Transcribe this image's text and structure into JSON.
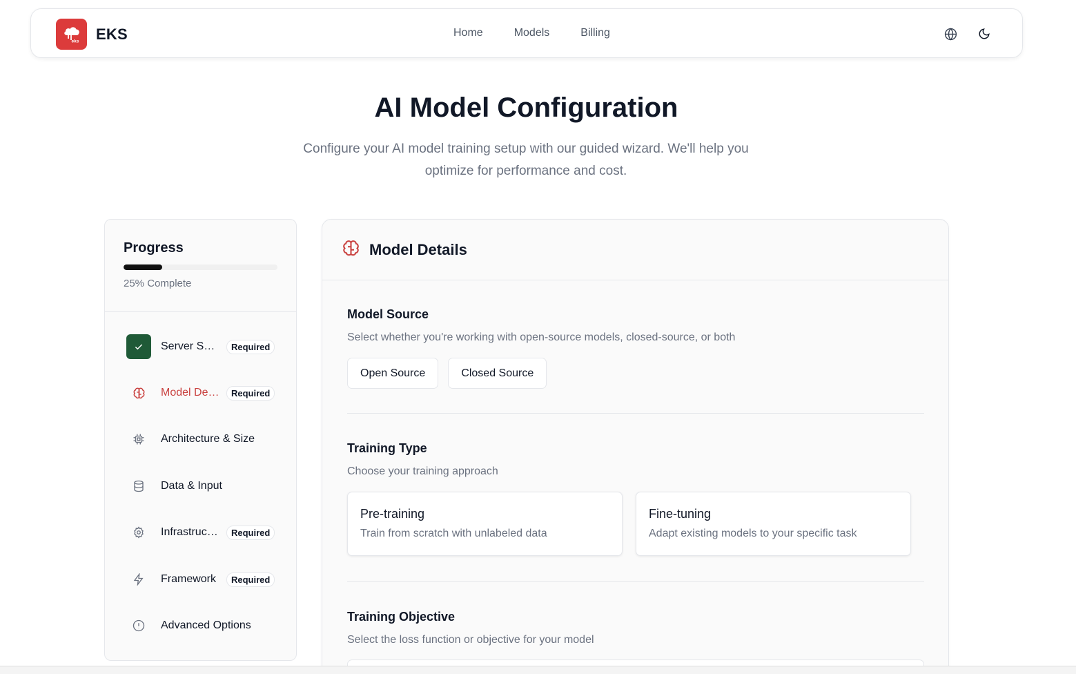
{
  "brand": {
    "name": "EKS",
    "logo_text": "eks"
  },
  "nav": {
    "links": [
      "Home",
      "Models",
      "Billing"
    ]
  },
  "icons": {
    "language": "globe-icon",
    "theme": "moon-icon"
  },
  "hero": {
    "title": "AI Model Configuration",
    "subtitle": "Configure your AI model training setup with our guided wizard. We'll help you optimize for performance and cost."
  },
  "progress": {
    "title": "Progress",
    "percent": 25,
    "label": "25% Complete"
  },
  "steps": [
    {
      "label": "Server Setup",
      "required": "Required",
      "icon": "check-icon",
      "state": "completed"
    },
    {
      "label": "Model Details",
      "required": "Required",
      "icon": "brain-icon",
      "state": "active"
    },
    {
      "label": "Architecture & Size",
      "required": "",
      "icon": "cpu-icon",
      "state": "pending"
    },
    {
      "label": "Data & Input",
      "required": "",
      "icon": "database-icon",
      "state": "pending"
    },
    {
      "label": "Infrastructure",
      "required": "Required",
      "icon": "gear-icon",
      "state": "pending"
    },
    {
      "label": "Framework",
      "required": "Required",
      "icon": "lightning-icon",
      "state": "pending"
    },
    {
      "label": "Advanced Options",
      "required": "",
      "icon": "alert-circle-icon",
      "state": "pending"
    }
  ],
  "card": {
    "title": "Model Details",
    "icon": "brain-icon",
    "model_source": {
      "title": "Model Source",
      "description": "Select whether you're working with open-source models, closed-source, or both",
      "options": [
        "Open Source",
        "Closed Source"
      ]
    },
    "training_type": {
      "title": "Training Type",
      "description": "Choose your training approach",
      "options": [
        {
          "title": "Pre-training",
          "description": "Train from scratch with unlabeled data"
        },
        {
          "title": "Fine-tuning",
          "description": "Adapt existing models to your specific task"
        }
      ]
    },
    "training_objective": {
      "title": "Training Objective",
      "description": "Select the loss function or objective for your model"
    }
  },
  "colors": {
    "accent": "#dc3b3b",
    "active_step": "#c9413f",
    "completed": "#1f5a37",
    "progress_fill": "#111111"
  }
}
